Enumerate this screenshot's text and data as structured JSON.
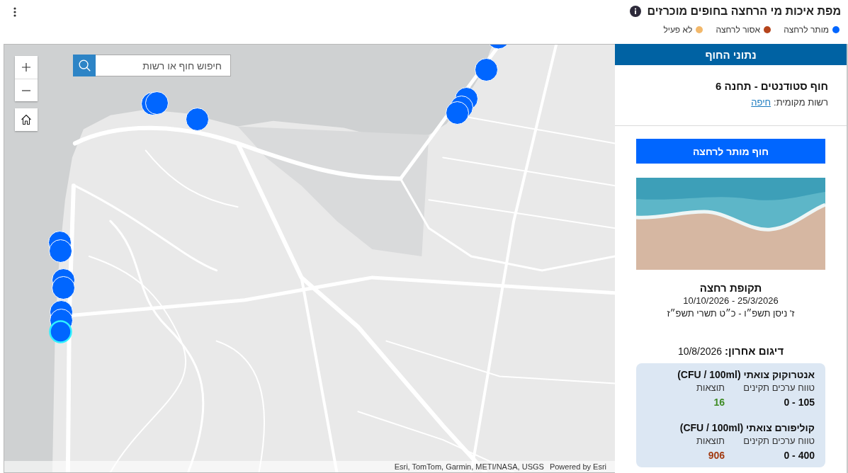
{
  "header": {
    "title": "מפת איכות מי הרחצה בחופים מוכרזים",
    "legend": [
      {
        "label": "מותר לרחצה",
        "color": "#0066ff"
      },
      {
        "label": "אסור לרחצה",
        "color": "#b5441c"
      },
      {
        "label": "לא פעיל",
        "color": "#f2b86b"
      }
    ]
  },
  "map": {
    "search": {
      "placeholder": "חיפוש חוף או רשות"
    },
    "markers": [
      {
        "kind": "single",
        "color": "#0066ff",
        "selected": false
      },
      {
        "kind": "single",
        "color": "#0066ff",
        "selected": false
      },
      {
        "kind": "stack",
        "color": "#0066ff",
        "selected": false
      },
      {
        "kind": "stack",
        "color": "#0066ff",
        "selected": false
      },
      {
        "kind": "single",
        "color": "#0066ff",
        "selected": false
      },
      {
        "kind": "stack",
        "color": "#0066ff",
        "selected": false
      },
      {
        "kind": "stack",
        "color": "#0066ff",
        "selected": false
      },
      {
        "kind": "stack",
        "color": "#0066ff",
        "selected": true
      }
    ],
    "attribution": "Esri, TomTom, Garmin, METI/NASA, USGS",
    "powered_by": "Powered by Esri"
  },
  "panel": {
    "title": "נתוני החוף",
    "beach_name": "חוף סטודנטים - תחנה 6",
    "authority_label": "רשות מקומית:",
    "authority": "חיפה",
    "status": "חוף מותר לרחצה",
    "season": {
      "title": "תקופת רחצה",
      "dates": "25/3/2026 - 10/10/2026",
      "hebrew_dates": "ז' ניסן תשפ״ו - כ״ט תשרי תשפ״ז"
    },
    "last_sample": "**דיגום אחרון:** 10/8/2026",
    "tests": [
      {
        "title": "אנטרוקוק צואתי (CFU / 100ml)",
        "range_label": "טווח ערכים תקינים",
        "result_label": "תוצאות",
        "range": "0 - 105",
        "result": "16",
        "color": "#3e8b24"
      },
      {
        "title": "קוליפורם צואתי (CFU / 100ml)",
        "range_label": "טווח ערכים תקינים",
        "result_label": "תוצאות",
        "range": "0 - 400",
        "result": "906",
        "color": "#a23b12"
      }
    ]
  }
}
